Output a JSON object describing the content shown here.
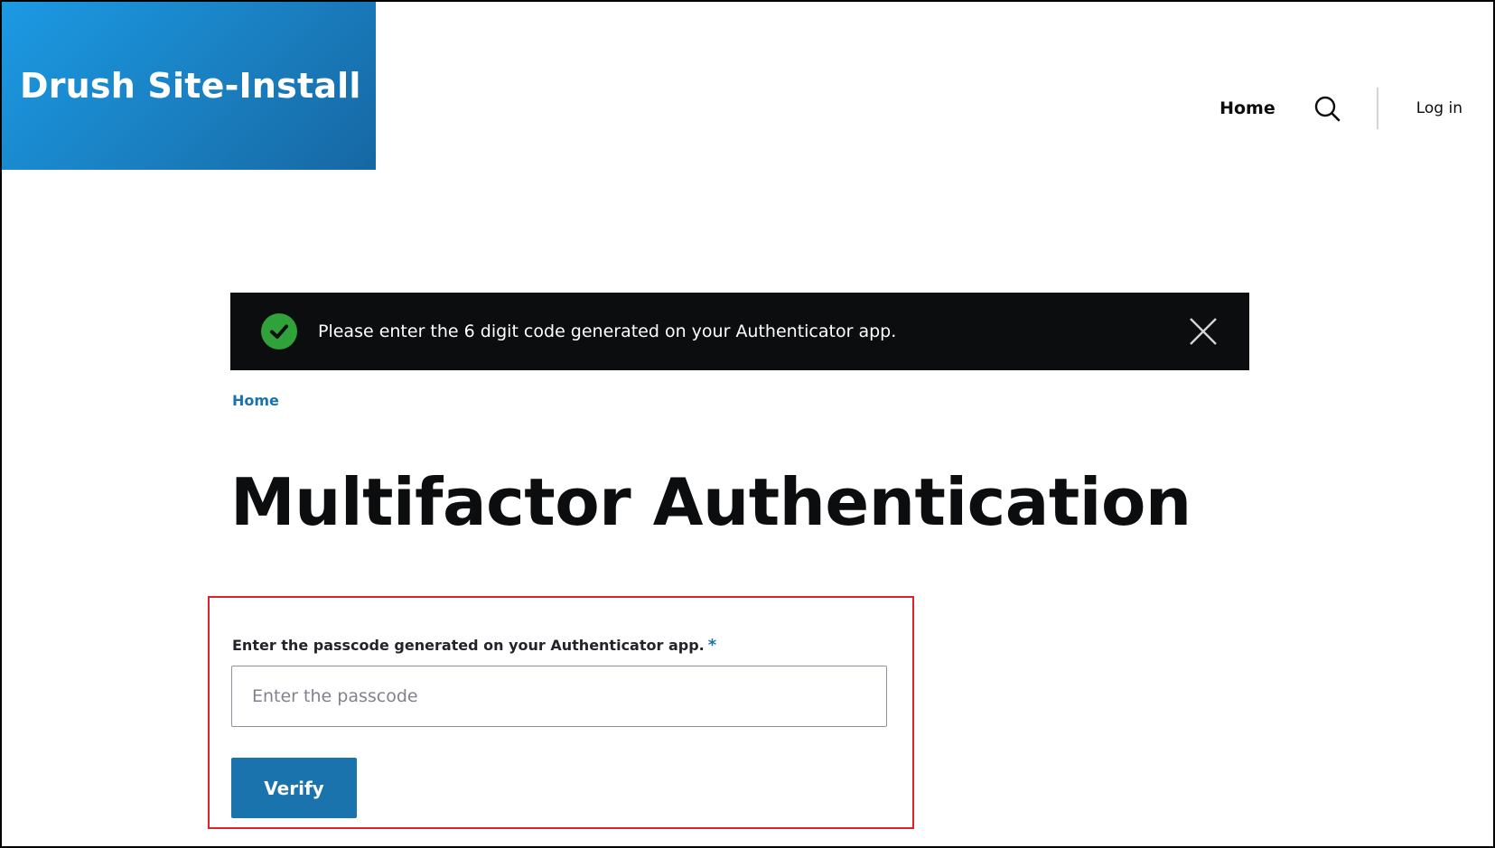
{
  "site": {
    "name": "Drush Site-Install"
  },
  "nav": {
    "home_label": "Home",
    "search_icon": "search-icon",
    "login_label": "Log in"
  },
  "message": {
    "icon": "check-circle-icon",
    "text": "Please enter the 6 digit code generated on your Authenticator app.",
    "close_icon": "close-icon"
  },
  "breadcrumb": {
    "home_label": "Home"
  },
  "page": {
    "title": "Multifactor Authentication"
  },
  "form": {
    "label": "Enter the passcode generated on your Authenticator app.",
    "required_mark": "*",
    "input_value": "",
    "input_placeholder": "Enter the passcode",
    "submit_label": "Verify"
  },
  "colors": {
    "brand": "#1b7fc0",
    "message_bg": "#0c0d0e",
    "success": "#2fa23a",
    "link": "#1b73ad",
    "highlight": "#d9232d"
  }
}
